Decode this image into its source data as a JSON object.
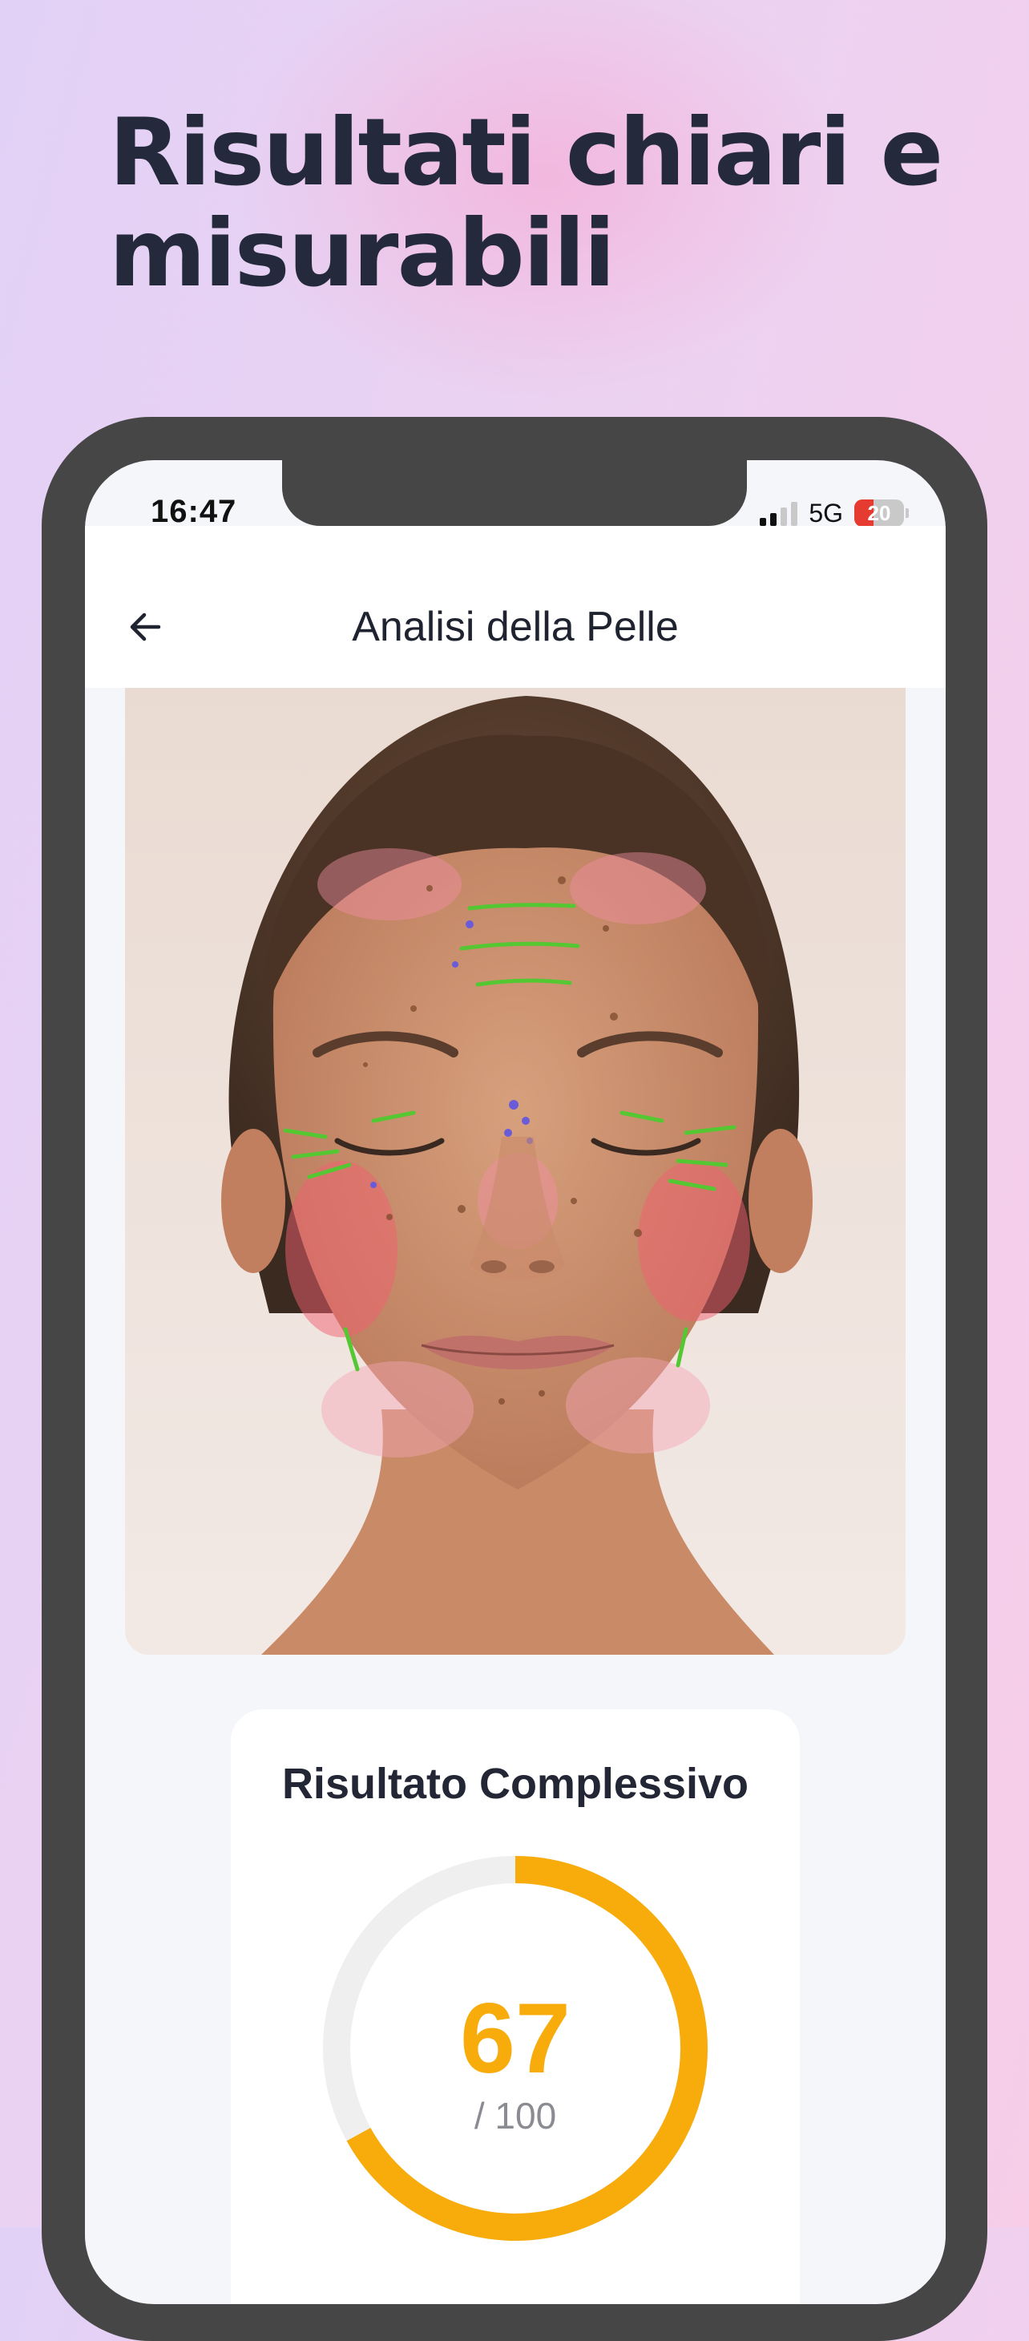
{
  "headline": {
    "line1": "Risultati chiari e",
    "line2": "misurabili"
  },
  "status_bar": {
    "time": "16:47",
    "network": "5G",
    "battery": "20"
  },
  "app_bar": {
    "title": "Analisi della Pelle",
    "back_icon": "arrow-left-icon"
  },
  "result_card": {
    "title": "Risultato Complessivo",
    "score": "67",
    "max": "/ 100",
    "score_fraction": 0.67
  },
  "colors": {
    "accent": "#f7ac0c",
    "track": "#efefef",
    "text_dark": "#242a3c"
  }
}
